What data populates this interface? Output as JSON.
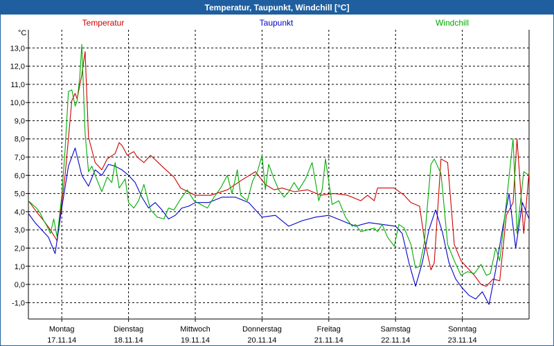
{
  "window": {
    "title": "Temperatur, Taupunkt, Windchill [°C]"
  },
  "chart_data": {
    "type": "line",
    "title": "Temperatur, Taupunkt, Windchill [°C]",
    "ylabel": "°C",
    "ylim": [
      -1.9,
      14.0
    ],
    "yticks": [
      -1.0,
      0.0,
      1.0,
      2.0,
      3.0,
      4.0,
      5.0,
      6.0,
      7.0,
      8.0,
      9.0,
      10.0,
      11.0,
      12.0,
      13.0
    ],
    "ytick_labels": [
      "-1,0",
      "0,0",
      "1,0",
      "2,0",
      "3,0",
      "4,0",
      "5,0",
      "6,0",
      "7,0",
      "8,0",
      "9,0",
      "10,0",
      "11,0",
      "12,0",
      "13,0"
    ],
    "xlim": [
      -0.5,
      7.0
    ],
    "x_ticks": [
      {
        "x": 0,
        "day": "Montag",
        "date": "17.11.14"
      },
      {
        "x": 1,
        "day": "Dienstag",
        "date": "18.11.14"
      },
      {
        "x": 2,
        "day": "Mittwoch",
        "date": "19.11.14"
      },
      {
        "x": 3,
        "day": "Donnerstag",
        "date": "20.11.14"
      },
      {
        "x": 4,
        "day": "Freitag",
        "date": "21.11.14"
      },
      {
        "x": 5,
        "day": "Samstag",
        "date": "22.11.14"
      },
      {
        "x": 6,
        "day": "Sonntag",
        "date": "23.11.14"
      }
    ],
    "grid": true,
    "legend_position": "top",
    "series": [
      {
        "name": "Temperatur",
        "color": "#cc0000",
        "x": [
          -0.5,
          -0.38,
          -0.27,
          -0.17,
          -0.07,
          0.05,
          0.15,
          0.2,
          0.23,
          0.3,
          0.35,
          0.4,
          0.5,
          0.6,
          0.68,
          0.8,
          0.86,
          0.91,
          0.98,
          1.08,
          1.13,
          1.23,
          1.33,
          1.53,
          1.68,
          1.78,
          2.0,
          2.23,
          2.48,
          2.68,
          2.9,
          3.05,
          3.18,
          3.3,
          3.48,
          3.68,
          3.88,
          4.08,
          4.28,
          4.48,
          4.58,
          4.68,
          4.73,
          4.98,
          5.13,
          5.23,
          5.36,
          5.43,
          5.53,
          5.58,
          5.68,
          5.78,
          5.88,
          5.98,
          6.18,
          6.28,
          6.36,
          6.46,
          6.56,
          6.66,
          6.76,
          6.82,
          6.92,
          7.0
        ],
        "y": [
          4.6,
          4.0,
          3.5,
          3.0,
          2.4,
          6.0,
          10.1,
          10.5,
          10.2,
          11.5,
          12.8,
          8.1,
          6.7,
          6.3,
          6.9,
          7.2,
          7.8,
          7.6,
          7.1,
          7.3,
          7.0,
          6.7,
          7.1,
          6.4,
          5.9,
          5.3,
          4.9,
          4.9,
          5.2,
          5.7,
          6.2,
          5.5,
          5.2,
          5.3,
          5.1,
          5.2,
          4.9,
          5.0,
          4.9,
          4.6,
          4.9,
          4.6,
          5.3,
          5.3,
          4.9,
          4.5,
          4.3,
          2.5,
          0.8,
          1.2,
          6.9,
          6.7,
          2.2,
          1.3,
          0.5,
          0.0,
          -0.1,
          0.3,
          0.2,
          3.8,
          4.5,
          8.0,
          2.8,
          6.2
        ],
        "markers": "none"
      },
      {
        "name": "Taupunkt",
        "color": "#0000cc",
        "x": [
          -0.5,
          -0.4,
          -0.3,
          -0.2,
          -0.1,
          0.0,
          0.1,
          0.2,
          0.3,
          0.4,
          0.5,
          0.6,
          0.7,
          0.8,
          0.9,
          1.0,
          1.1,
          1.2,
          1.3,
          1.4,
          1.5,
          1.6,
          1.7,
          1.8,
          1.9,
          2.0,
          2.2,
          2.4,
          2.6,
          2.8,
          3.0,
          3.2,
          3.4,
          3.6,
          3.8,
          4.0,
          4.2,
          4.4,
          4.6,
          4.8,
          5.0,
          5.1,
          5.2,
          5.3,
          5.4,
          5.5,
          5.6,
          5.7,
          5.8,
          5.9,
          6.0,
          6.1,
          6.2,
          6.3,
          6.4,
          6.5,
          6.6,
          6.7,
          6.8,
          6.9,
          7.0
        ],
        "y": [
          3.9,
          3.4,
          3.0,
          2.6,
          1.7,
          4.2,
          6.5,
          7.5,
          6.0,
          5.4,
          6.3,
          6.0,
          6.6,
          6.5,
          6.3,
          6.0,
          5.6,
          4.8,
          4.2,
          4.5,
          4.1,
          3.6,
          3.8,
          4.2,
          4.3,
          4.5,
          4.5,
          4.8,
          4.8,
          4.5,
          3.7,
          3.8,
          3.2,
          3.5,
          3.7,
          3.8,
          3.5,
          3.2,
          3.4,
          3.3,
          3.2,
          2.8,
          1.2,
          -0.1,
          1.2,
          3.0,
          4.1,
          2.9,
          1.2,
          0.3,
          -0.2,
          -0.6,
          -0.8,
          -0.4,
          -1.1,
          0.8,
          3.0,
          5.0,
          2.0,
          4.5,
          3.6
        ],
        "markers": "none"
      },
      {
        "name": "Windchill",
        "color": "#00aa00",
        "x": [
          -0.5,
          -0.44,
          -0.38,
          -0.32,
          -0.27,
          -0.22,
          -0.17,
          -0.12,
          -0.07,
          0.0,
          0.05,
          0.1,
          0.15,
          0.2,
          0.23,
          0.27,
          0.3,
          0.35,
          0.4,
          0.45,
          0.5,
          0.6,
          0.68,
          0.75,
          0.8,
          0.86,
          0.95,
          1.0,
          1.08,
          1.15,
          1.23,
          1.33,
          1.43,
          1.53,
          1.6,
          1.68,
          1.78,
          1.88,
          1.98,
          2.08,
          2.18,
          2.28,
          2.38,
          2.48,
          2.55,
          2.63,
          2.68,
          2.78,
          2.86,
          2.93,
          3.0,
          3.05,
          3.1,
          3.18,
          3.25,
          3.33,
          3.4,
          3.48,
          3.55,
          3.65,
          3.75,
          3.85,
          3.9,
          3.95,
          4.05,
          4.15,
          4.25,
          4.35,
          4.4,
          4.48,
          4.58,
          4.68,
          4.73,
          4.8,
          4.88,
          4.98,
          5.05,
          5.13,
          5.23,
          5.3,
          5.36,
          5.43,
          5.53,
          5.58,
          5.68,
          5.78,
          5.88,
          5.98,
          6.08,
          6.18,
          6.28,
          6.36,
          6.42,
          6.5,
          6.56,
          6.66,
          6.76,
          6.82,
          6.92,
          7.0
        ],
        "y": [
          4.6,
          4.4,
          4.2,
          3.9,
          3.5,
          3.2,
          2.8,
          3.6,
          2.6,
          4.9,
          7.4,
          10.6,
          10.7,
          9.8,
          10.1,
          11.4,
          13.2,
          8.3,
          6.2,
          6.5,
          6.0,
          5.1,
          5.9,
          5.6,
          6.7,
          5.3,
          5.8,
          4.5,
          4.2,
          4.6,
          5.5,
          4.1,
          3.7,
          3.6,
          4.2,
          4.1,
          4.7,
          5.2,
          4.6,
          4.4,
          4.2,
          4.8,
          5.3,
          6.0,
          5.0,
          6.3,
          4.9,
          4.6,
          5.7,
          6.2,
          7.1,
          5.2,
          6.6,
          5.8,
          5.2,
          4.8,
          5.1,
          5.6,
          5.2,
          5.8,
          6.7,
          4.6,
          5.2,
          6.9,
          4.4,
          4.6,
          3.7,
          3.2,
          3.3,
          2.9,
          3.0,
          3.1,
          2.9,
          3.3,
          2.6,
          2.1,
          3.3,
          3.1,
          2.2,
          0.9,
          1.0,
          2.3,
          6.6,
          6.9,
          6.1,
          2.2,
          1.3,
          0.5,
          0.7,
          0.6,
          1.1,
          0.5,
          0.6,
          2.0,
          1.3,
          4.5,
          8.0,
          2.8,
          6.2,
          6.0
        ],
        "markers": "none"
      }
    ]
  }
}
